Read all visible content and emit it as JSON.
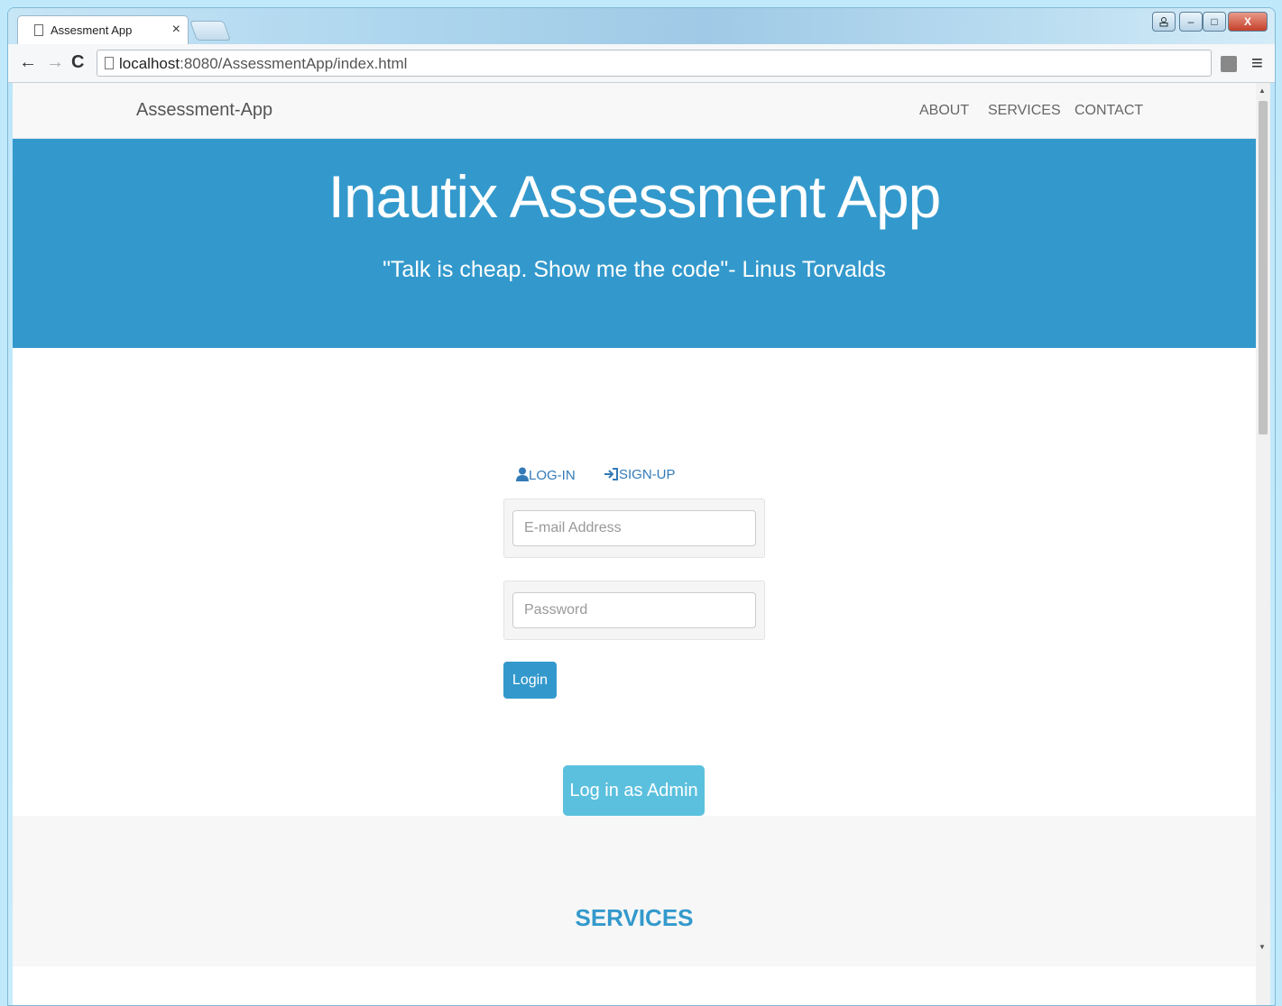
{
  "browser": {
    "tab_title": "Assesment App",
    "tab_close": "×",
    "url_host": "localhost",
    "url_path": ":8080/AssessmentApp/index.html",
    "window_controls": {
      "user": "",
      "minimize": "–",
      "maximize": "□",
      "close": "X"
    }
  },
  "site": {
    "brand": "Assessment-App",
    "nav": [
      "ABOUT",
      "SERVICES",
      "CONTACT"
    ]
  },
  "hero": {
    "title": "Inautix Assessment App",
    "subtitle": "\"Talk is cheap. Show me the code\"- Linus Torvalds"
  },
  "login": {
    "tab_login": "LOG-IN",
    "tab_signup": "SIGN-UP",
    "email_placeholder": "E-mail Address",
    "password_placeholder": "Password",
    "login_button": "Login",
    "admin_button": "Log in as Admin"
  },
  "services": {
    "heading": "SERVICES"
  },
  "colors": {
    "primary": "#3399cc",
    "info": "#5bc0de"
  }
}
